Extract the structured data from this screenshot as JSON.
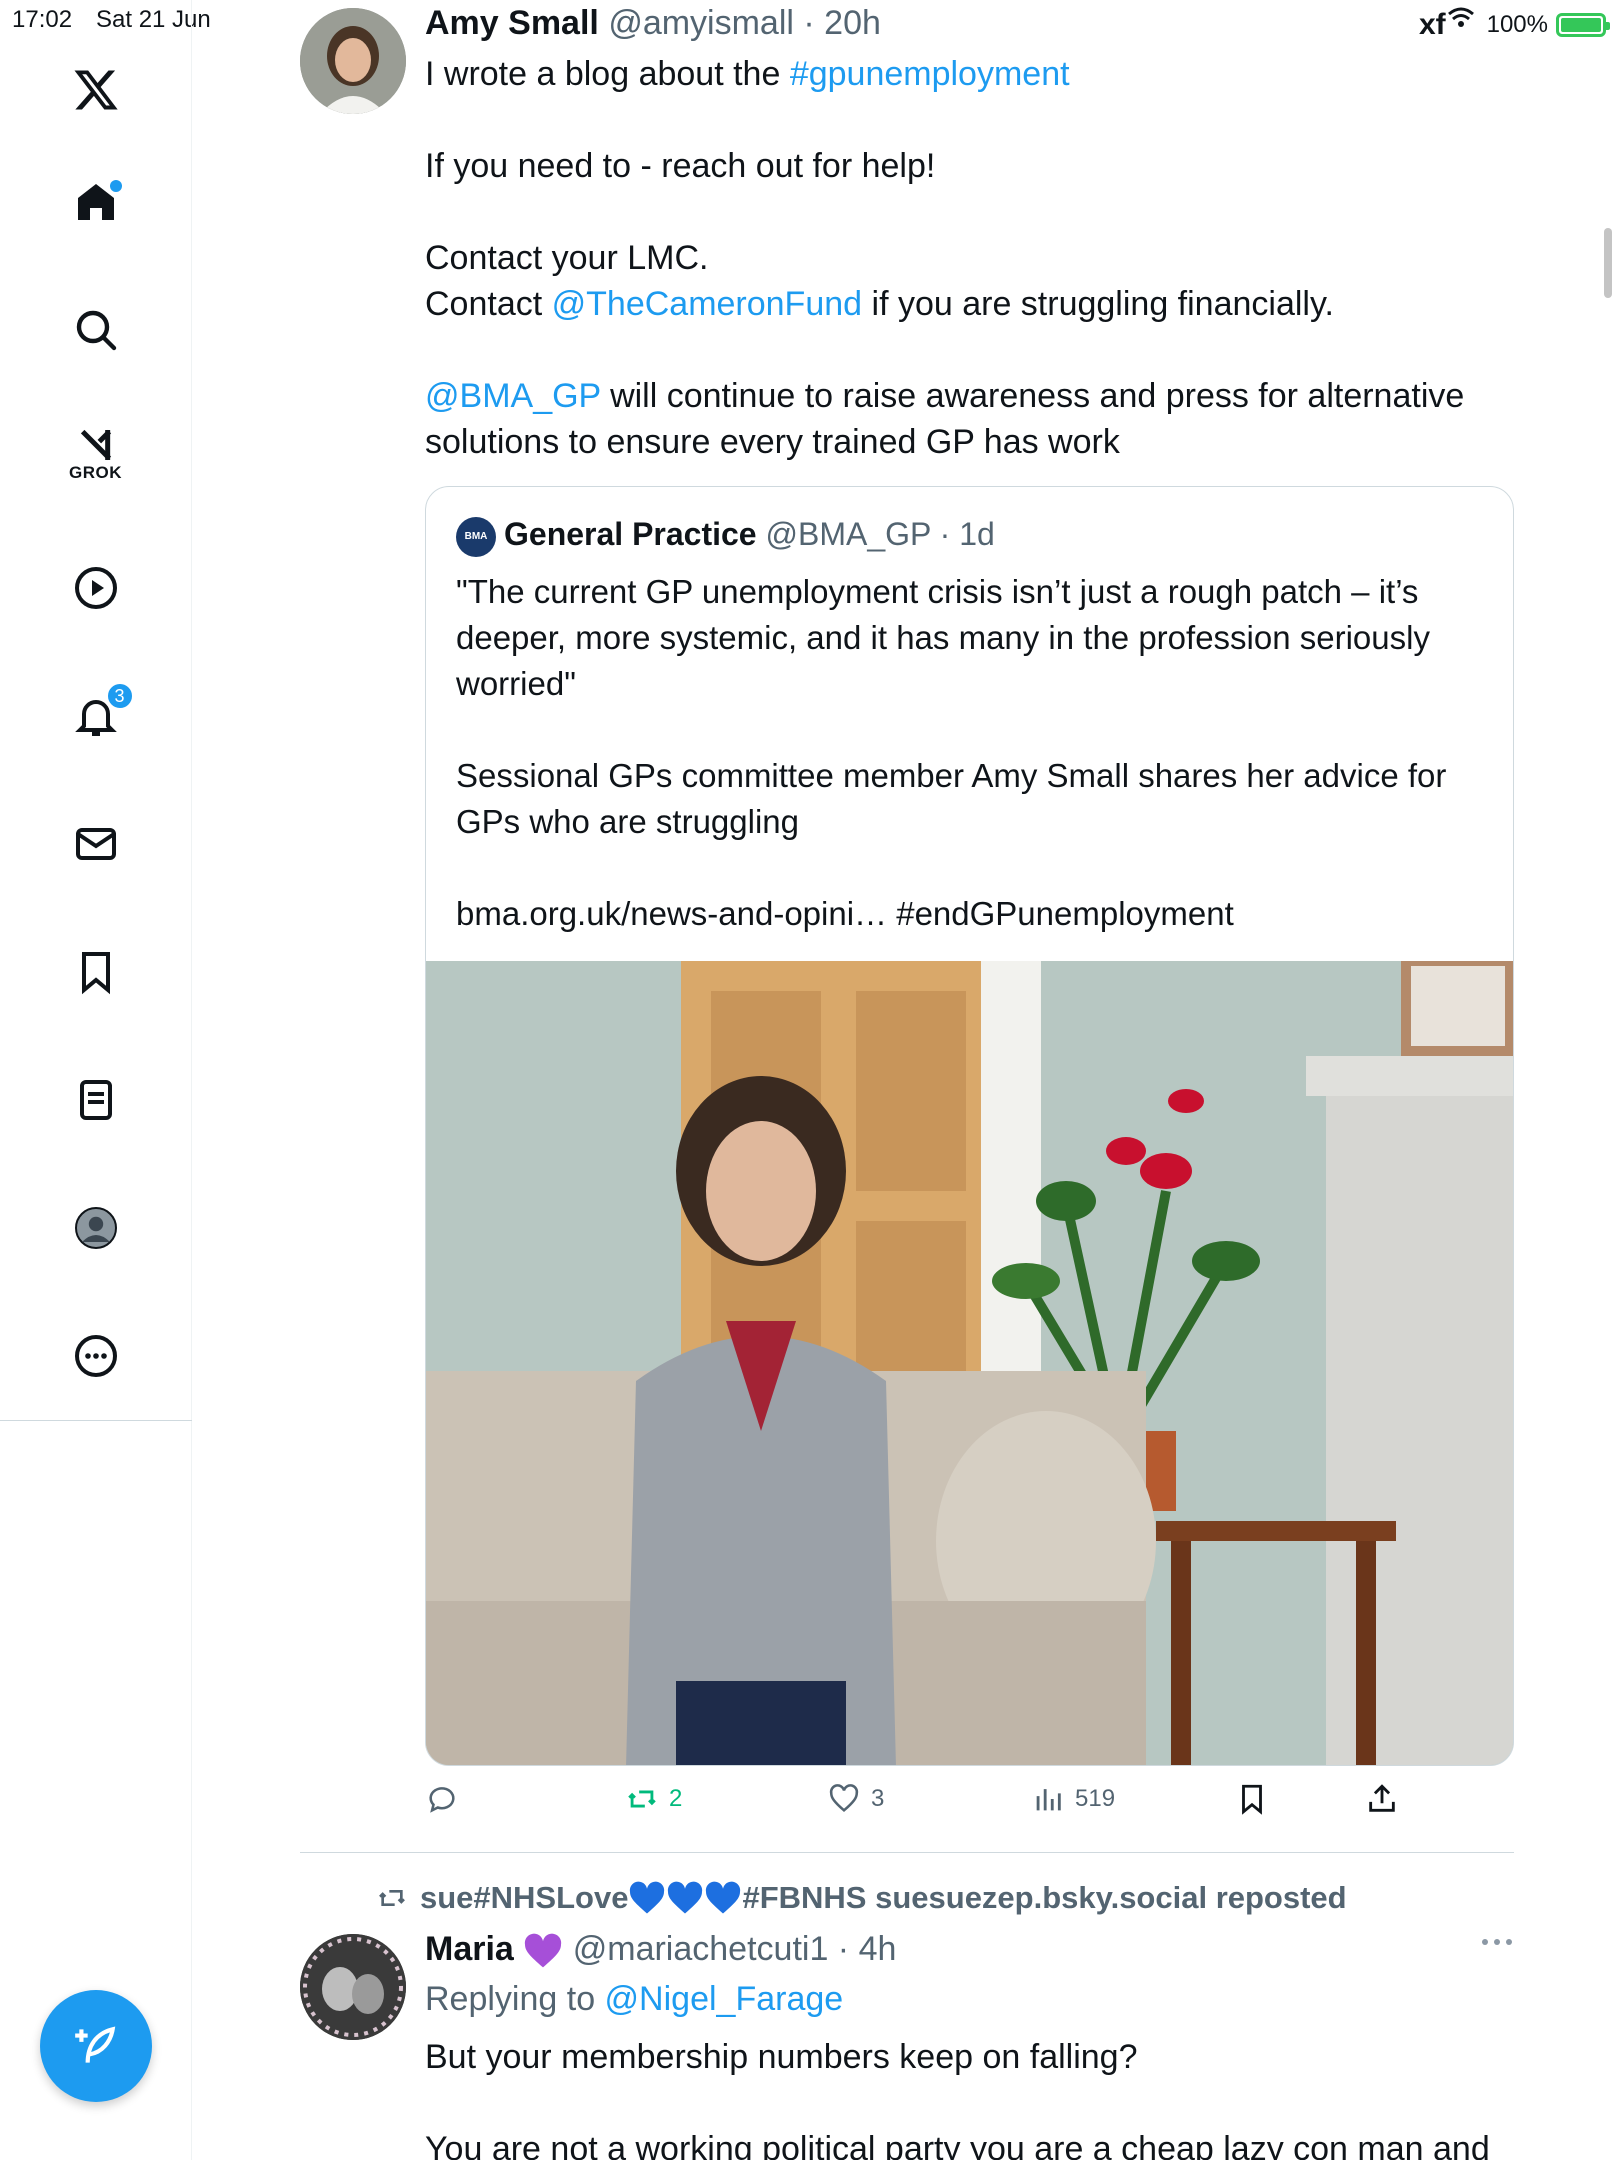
{
  "status_bar": {
    "time": "17:02",
    "date": "Sat 21 Jun",
    "battery": "100%"
  },
  "sidebar": {
    "items": [
      {
        "name": "x-logo-icon"
      },
      {
        "name": "home-icon"
      },
      {
        "name": "search-icon"
      },
      {
        "name": "grok-icon",
        "label": "GROK"
      },
      {
        "name": "video-icon"
      },
      {
        "name": "notifications-icon",
        "badge": "3"
      },
      {
        "name": "messages-icon"
      },
      {
        "name": "bookmarks-icon"
      },
      {
        "name": "lists-icon"
      },
      {
        "name": "profile-icon"
      },
      {
        "name": "more-icon"
      }
    ],
    "accent": "#1d9bf0"
  },
  "tweet": {
    "author_name": "Amy Small",
    "author_handle": "@amyismall",
    "timestamp": "20h",
    "line1_prefix": "I wrote a blog about the ",
    "line1_hashtag": "#gpunemployment",
    "line2": "If you need to - reach out for help!",
    "line3": "Contact your LMC.",
    "line4_prefix": "Contact ",
    "line4_mention": "@TheCameronFund",
    "line4_suffix": " if you are struggling financially.",
    "line5_mention": "@BMA_GP",
    "line5_suffix": " will continue to raise awareness and press for alternative",
    "line6": "solutions to ensure every trained GP has work"
  },
  "quote": {
    "logo_text": "BMA",
    "name": "General Practice",
    "handle": "@BMA_GP",
    "timestamp": "1d",
    "line1": "\"The current GP unemployment crisis isn’t just a rough patch – it’s",
    "line2": "deeper, more systemic, and it has many in the profession seriously",
    "line3": "worried\"",
    "line4": "Sessional GPs committee member Amy Small shares her advice for",
    "line5": "GPs who are struggling",
    "line6": "bma.org.uk/news-and-opini… #endGPunemployment"
  },
  "actions": {
    "reposts": "2",
    "likes": "3",
    "views": "519"
  },
  "next_tweet": {
    "repost_by": "sue#NHSLove",
    "repost_by_suffix": "#FBNHS suesuezep.bsky.social reposted",
    "author_name": "Maria",
    "author_handle": "@mariachetcuti1",
    "timestamp": "4h",
    "replying_prefix": "Replying to ",
    "replying_to": "@Nigel_Farage",
    "line1": "But your membership numbers keep on falling?",
    "line2": "You are not a working political party you are a cheap lazy con man and"
  },
  "colors": {
    "accent": "#1d9bf0",
    "repost_green": "#00ba7c",
    "muted": "#536471",
    "heart_blue": "#1d6fe0",
    "purple_heart": "#a64fd8"
  }
}
